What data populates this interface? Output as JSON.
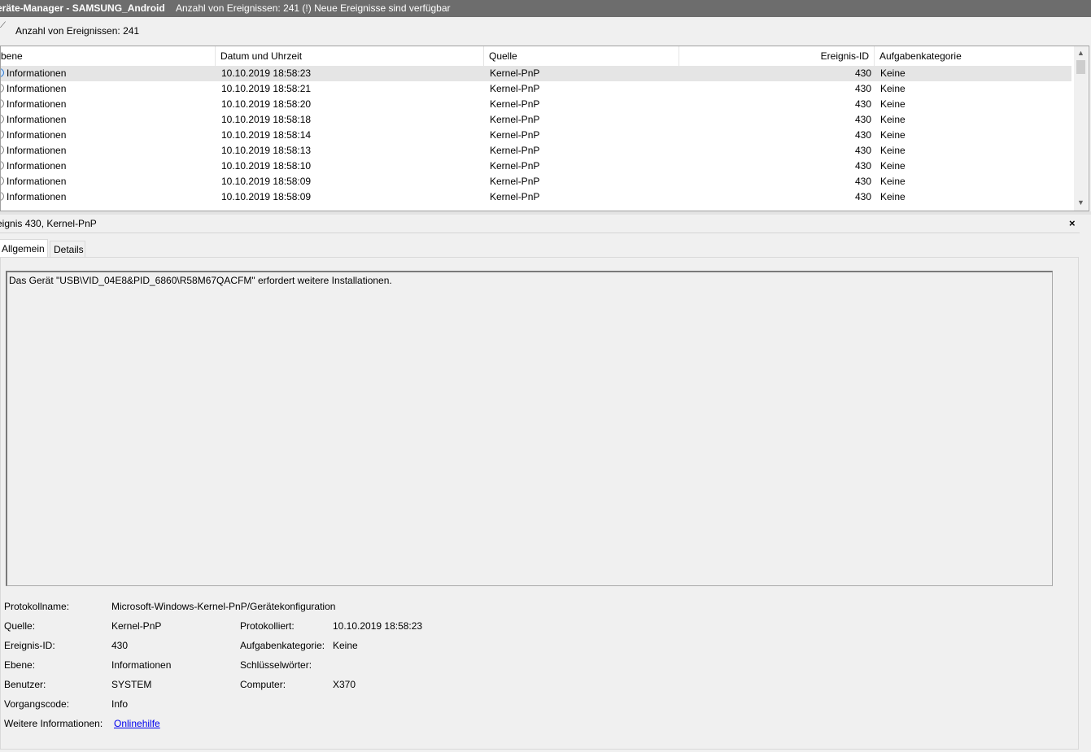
{
  "window": {
    "title": "eräte-Manager - SAMSUNG_Android",
    "status": "Anzahl von Ereignissen: 241 (!) Neue Ereignisse sind verfügbar"
  },
  "event_count": "Anzahl von Ereignissen: 241",
  "table": {
    "columns": [
      "bene",
      "Datum und Uhrzeit",
      "Quelle",
      "Ereignis-ID",
      "Aufgabenkategorie"
    ],
    "rows": [
      {
        "level": "Informationen",
        "date": "10.10.2019 18:58:23",
        "source": "Kernel-PnP",
        "id": "430",
        "category": "Keine"
      },
      {
        "level": "Informationen",
        "date": "10.10.2019 18:58:21",
        "source": "Kernel-PnP",
        "id": "430",
        "category": "Keine"
      },
      {
        "level": "Informationen",
        "date": "10.10.2019 18:58:20",
        "source": "Kernel-PnP",
        "id": "430",
        "category": "Keine"
      },
      {
        "level": "Informationen",
        "date": "10.10.2019 18:58:18",
        "source": "Kernel-PnP",
        "id": "430",
        "category": "Keine"
      },
      {
        "level": "Informationen",
        "date": "10.10.2019 18:58:14",
        "source": "Kernel-PnP",
        "id": "430",
        "category": "Keine"
      },
      {
        "level": "Informationen",
        "date": "10.10.2019 18:58:13",
        "source": "Kernel-PnP",
        "id": "430",
        "category": "Keine"
      },
      {
        "level": "Informationen",
        "date": "10.10.2019 18:58:10",
        "source": "Kernel-PnP",
        "id": "430",
        "category": "Keine"
      },
      {
        "level": "Informationen",
        "date": "10.10.2019 18:58:09",
        "source": "Kernel-PnP",
        "id": "430",
        "category": "Keine"
      },
      {
        "level": "Informationen",
        "date": "10.10.2019 18:58:09",
        "source": "Kernel-PnP",
        "id": "430",
        "category": "Keine"
      }
    ]
  },
  "detail": {
    "title": "eignis 430, Kernel-PnP",
    "close": "×",
    "tabs": [
      "Allgemein",
      "Details"
    ],
    "description": "Das Gerät \"USB\\VID_04E8&PID_6860\\R58M67QACFM\" erfordert weitere Installationen.",
    "labels": {
      "log_name": "Protokollname:",
      "source": "Quelle:",
      "event_id": "Ereignis-ID:",
      "level": "Ebene:",
      "user": "Benutzer:",
      "opcode": "Vorgangscode:",
      "more_info": "Weitere Informationen:",
      "logged": "Protokolliert:",
      "task_category": "Aufgabenkategorie:",
      "keywords": "Schlüsselwörter:",
      "computer": "Computer:"
    },
    "values": {
      "log_name": "Microsoft-Windows-Kernel-PnP/Gerätekonfiguration",
      "source": "Kernel-PnP",
      "event_id": "430",
      "level": "Informationen",
      "user": "SYSTEM",
      "opcode": "Info",
      "more_info_link": "Onlinehilfe",
      "logged": "10.10.2019 18:58:23",
      "task_category": "Keine",
      "keywords": "",
      "computer": "X370"
    }
  }
}
